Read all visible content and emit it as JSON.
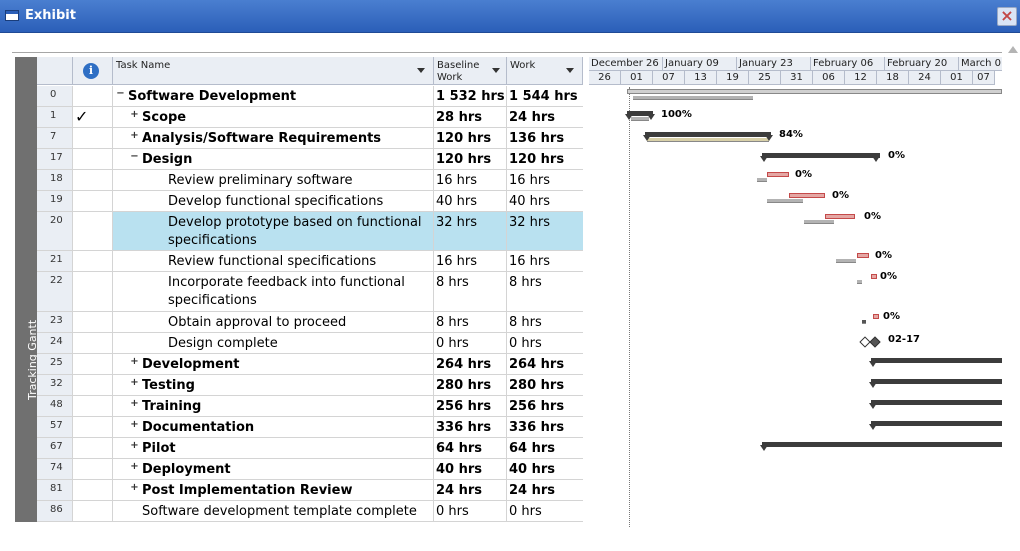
{
  "window": {
    "title": "Exhibit",
    "close_glyph": "×"
  },
  "side_panel": {
    "label": "Tracking Gantt"
  },
  "columns": {
    "task_name": "Task Name",
    "baseline_work": "Baseline Work",
    "work": "Work",
    "indicator_icon": "i"
  },
  "tasks": [
    {
      "id": "0",
      "name": "Software Development",
      "baseline": "1 532 hrs",
      "work": "1 544 hrs",
      "level": 0,
      "summary": "expanded"
    },
    {
      "id": "1",
      "name": "Scope",
      "baseline": "28 hrs",
      "work": "24 hrs",
      "level": 1,
      "summary": "collapsed",
      "check": "✓"
    },
    {
      "id": "7",
      "name": "Analysis/Software Requirements",
      "baseline": "120 hrs",
      "work": "136 hrs",
      "level": 1,
      "summary": "collapsed"
    },
    {
      "id": "17",
      "name": "Design",
      "baseline": "120 hrs",
      "work": "120 hrs",
      "level": 1,
      "summary": "expanded"
    },
    {
      "id": "18",
      "name": "Review preliminary software specifications",
      "baseline": "16 hrs",
      "work": "16 hrs",
      "level": 2
    },
    {
      "id": "19",
      "name": "Develop functional specifications",
      "baseline": "40 hrs",
      "work": "40 hrs",
      "level": 2
    },
    {
      "id": "20",
      "name": "Develop prototype based on functional specifications",
      "baseline": "32 hrs",
      "work": "32 hrs",
      "level": 2,
      "selected": true
    },
    {
      "id": "21",
      "name": "Review functional specifications",
      "baseline": "16 hrs",
      "work": "16 hrs",
      "level": 2
    },
    {
      "id": "22",
      "name": "Incorporate feedback into functional specifications",
      "baseline": "8 hrs",
      "work": "8 hrs",
      "level": 2
    },
    {
      "id": "23",
      "name": "Obtain approval to proceed",
      "baseline": "8 hrs",
      "work": "8 hrs",
      "level": 2
    },
    {
      "id": "24",
      "name": "Design complete",
      "baseline": "0 hrs",
      "work": "0 hrs",
      "level": 2
    },
    {
      "id": "25",
      "name": "Development",
      "baseline": "264 hrs",
      "work": "264 hrs",
      "level": 1,
      "summary": "collapsed"
    },
    {
      "id": "32",
      "name": "Testing",
      "baseline": "280 hrs",
      "work": "280 hrs",
      "level": 1,
      "summary": "collapsed"
    },
    {
      "id": "48",
      "name": "Training",
      "baseline": "256 hrs",
      "work": "256 hrs",
      "level": 1,
      "summary": "collapsed"
    },
    {
      "id": "57",
      "name": "Documentation",
      "baseline": "336 hrs",
      "work": "336 hrs",
      "level": 1,
      "summary": "collapsed"
    },
    {
      "id": "67",
      "name": "Pilot",
      "baseline": "64 hrs",
      "work": "64 hrs",
      "level": 1,
      "summary": "collapsed"
    },
    {
      "id": "74",
      "name": "Deployment",
      "baseline": "40 hrs",
      "work": "40 hrs",
      "level": 1,
      "summary": "collapsed"
    },
    {
      "id": "81",
      "name": "Post Implementation Review",
      "baseline": "24 hrs",
      "work": "24 hrs",
      "level": 1,
      "summary": "collapsed"
    },
    {
      "id": "86",
      "name": "Software development template complete",
      "baseline": "0 hrs",
      "work": "0 hrs",
      "level": 1
    }
  ],
  "timescale": {
    "major": [
      "December 26",
      "January 09",
      "January 23",
      "February 06",
      "February 20",
      "March 0"
    ],
    "minor": [
      "26",
      "01",
      "07",
      "13",
      "19",
      "25",
      "31",
      "06",
      "12",
      "18",
      "24",
      "01",
      "07"
    ]
  },
  "gantt_labels": {
    "scope": "100%",
    "analysis": "84%",
    "design": "0%",
    "t18": "0%",
    "t19": "0%",
    "t20": "0%",
    "t21": "0%",
    "t22": "0%",
    "t23": "0%",
    "milestone": "02-17"
  },
  "colors": {
    "title_bar": "#2b5fb8",
    "selected_row": "#b9e1f0",
    "critical_bar": "#e4a7a4",
    "summary_bar": "#3c3c3c",
    "baseline_bar": "#b3b3b3"
  }
}
